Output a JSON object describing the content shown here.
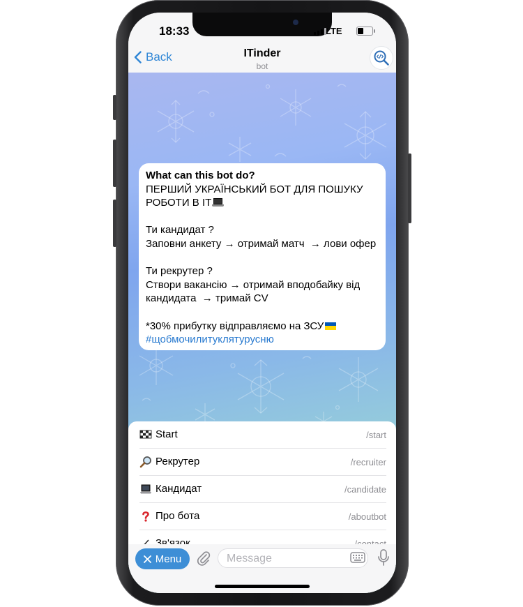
{
  "status_bar": {
    "time": "18:33",
    "network": "LTE"
  },
  "header": {
    "back_label": "Back",
    "title": "ITinder",
    "subtitle": "bot",
    "avatar_icon": "code-search-icon"
  },
  "bot_info": {
    "heading": "What can this bot do?",
    "line1": "ПЕРШИЙ УКРАЇНСЬКИЙ БОТ ДЛЯ ПОШУКУ",
    "line2": "РОБОТИ В ІТ",
    "candidate_title": "Ти кандидат ?",
    "candidate_steps": "Заповни анкету → отримай матч  → лови офер",
    "recruiter_title": "Ти рекрутер ?",
    "recruiter_line1": "Створи вакансію → отримай вподобайку від",
    "recruiter_line2": "кандидата  → тримай CV",
    "donation": "*30% прибутку відправляємо на ЗСУ",
    "hashtag": "#щобмочилитуклятурусню",
    "flag_colors": [
      "#0057b7",
      "#ffd700"
    ]
  },
  "commands": [
    {
      "icon": "checkered-flag-icon",
      "label": "Start",
      "command": "/start"
    },
    {
      "icon": "magnifier-icon",
      "label": "Рекрутер",
      "command": "/recruiter"
    },
    {
      "icon": "laptop-icon",
      "label": "Кандидат",
      "command": "/candidate"
    },
    {
      "icon": "question-mark-icon",
      "label": "Про бота",
      "command": "/aboutbot"
    },
    {
      "icon": "writing-hand-icon",
      "label": "Зв'язок",
      "command": "/contact"
    }
  ],
  "input_bar": {
    "menu_label": "Menu",
    "message_placeholder": "Message"
  },
  "colors": {
    "accent": "#3d8ed6",
    "link": "#2a7bd0"
  }
}
